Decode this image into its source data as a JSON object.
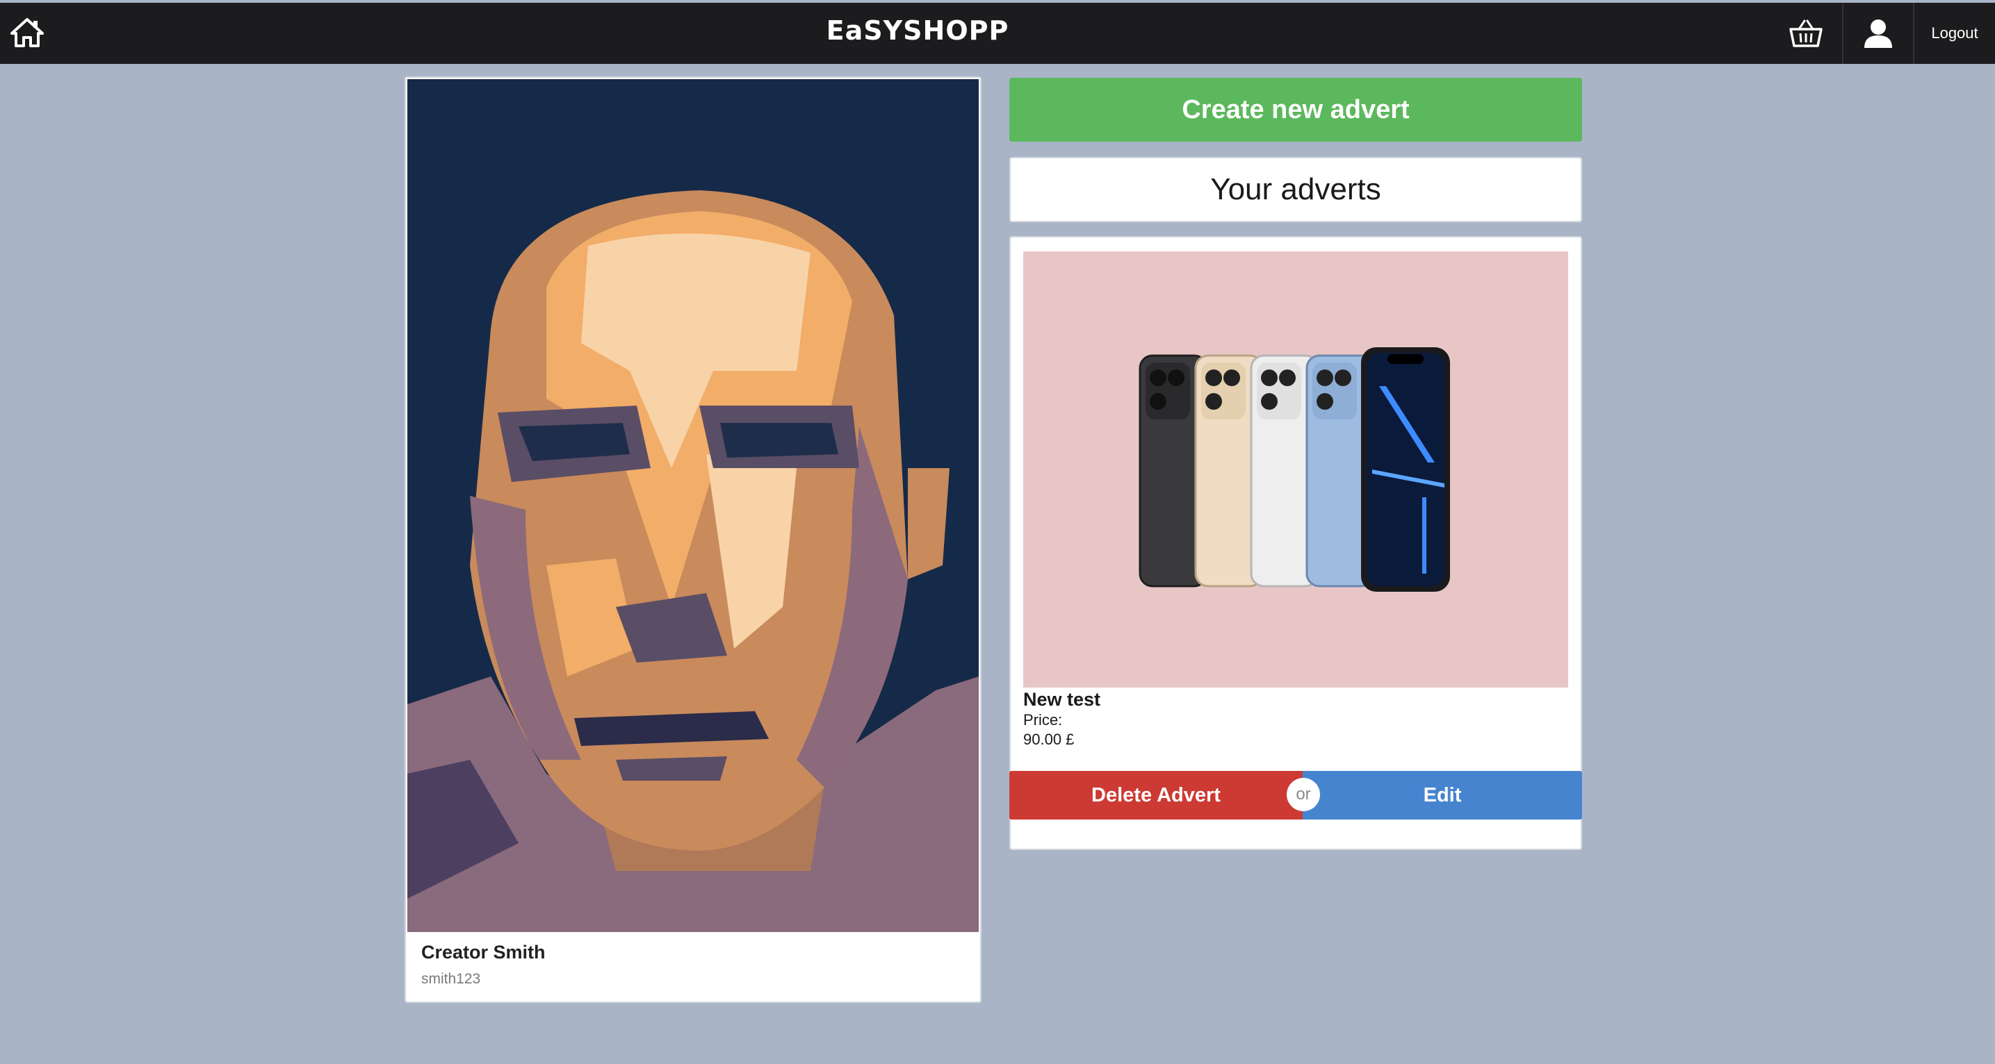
{
  "header": {
    "logo_text": "EaSYSHOPP",
    "logout_label": "Logout",
    "icons": {
      "home": "home-icon",
      "basket": "basket-icon",
      "profile": "user-icon"
    }
  },
  "profile": {
    "name": "Creator Smith",
    "username": "smith123"
  },
  "actions": {
    "create_label": "Create new advert"
  },
  "adverts_section": {
    "heading": "Your adverts",
    "items": [
      {
        "title": "New test",
        "price_label": "Price:",
        "price_value": "90.00 £",
        "delete_label": "Delete Advert",
        "or_label": "or",
        "edit_label": "Edit"
      }
    ]
  },
  "colors": {
    "page_bg": "#a9b5c7",
    "topbar": "#1c1c1e",
    "create": "#5cb85c",
    "delete": "#cc3a33",
    "edit": "#4684d0",
    "advert_image_bg": "#e8c6c6"
  }
}
